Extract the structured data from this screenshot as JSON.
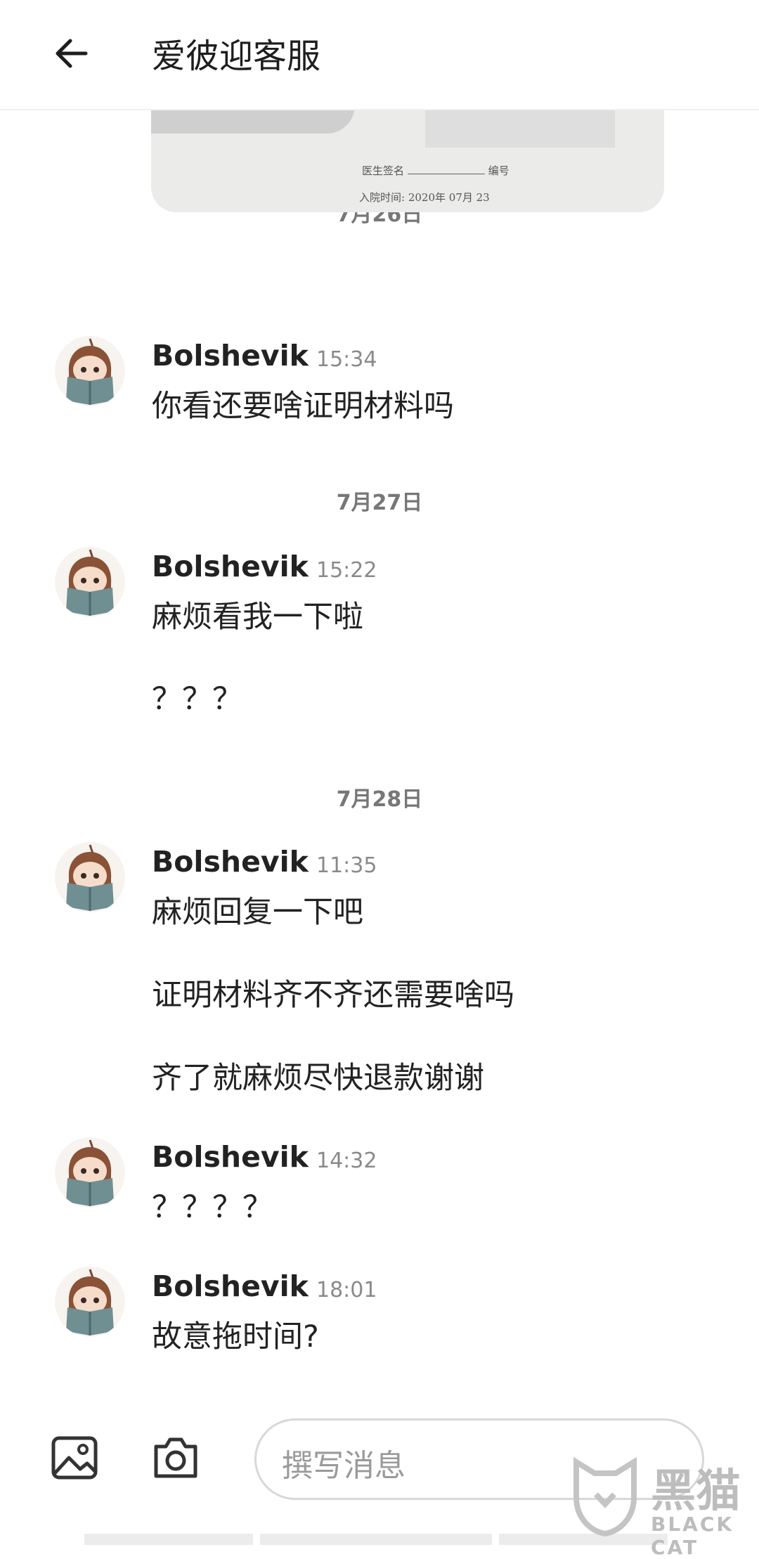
{
  "header": {
    "title": "爱彼迎客服"
  },
  "image_message": {
    "doctor_sign_label": "医生签名",
    "number_label": "编号",
    "admit_time_label": "入院时间:",
    "admit_time_value": "2020年 07月 23"
  },
  "messages": [
    {
      "date": "7月26日",
      "sender": "Bolshevik",
      "time": "15:34",
      "lines": [
        "你看还要啥证明材料吗"
      ]
    },
    {
      "date": "7月27日",
      "sender": "Bolshevik",
      "time": "15:22",
      "lines": [
        "麻烦看我一下啦",
        "？？？"
      ]
    },
    {
      "date": "7月28日",
      "sender": "Bolshevik",
      "time": "11:35",
      "lines": [
        "麻烦回复一下吧",
        "证明材料齐不齐还需要啥吗",
        "齐了就麻烦尽快退款谢谢"
      ]
    },
    {
      "sender": "Bolshevik",
      "time": "14:32",
      "lines": [
        "？？？？"
      ]
    },
    {
      "sender": "Bolshevik",
      "time": "18:01",
      "lines": [
        "故意拖时间?"
      ]
    }
  ],
  "composer": {
    "placeholder": "撰写消息"
  },
  "watermark": {
    "text": "黑猫",
    "sub": "BLACK CAT"
  },
  "icons": [
    "back-arrow-icon",
    "gallery-icon",
    "camera-icon",
    "avatar",
    "black-cat-logo"
  ]
}
